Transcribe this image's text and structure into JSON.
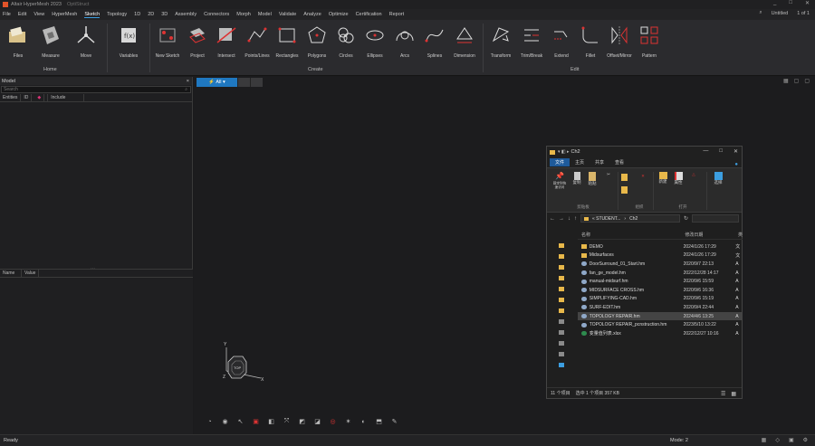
{
  "window": {
    "title": "Altair HyperMesh 2023",
    "profile": "OptiStruct",
    "controls": [
      "_",
      "□",
      "✕"
    ]
  },
  "menu": {
    "items": [
      "File",
      "Edit",
      "View",
      "HyperMesh",
      "Sketch",
      "Topology",
      "1D",
      "2D",
      "3D",
      "Assembly",
      "Connectors",
      "Morph",
      "Model",
      "Validate",
      "Analyze",
      "Optimize",
      "Certification",
      "Report"
    ],
    "active": "Sketch",
    "right_label": "Untitled",
    "page_indicator": "1 of 1"
  },
  "ribbon": {
    "home_buttons": [
      "Files",
      "Measure",
      "Move"
    ],
    "variables": "Variables",
    "create_buttons": [
      "New Sketch",
      "Project",
      "Intersect",
      "Points/Lines",
      "Rectangles",
      "Polygons",
      "Circles",
      "Ellipses",
      "Arcs",
      "Splines",
      "Dimension"
    ],
    "edit_buttons": [
      "Transform",
      "Trim/Break",
      "Extend",
      "Fillet",
      "Offset/Mirror",
      "Pattern"
    ],
    "groups": {
      "home": "Home",
      "create": "Create",
      "edit": "Edit"
    }
  },
  "left_panel": {
    "title": "Model",
    "search_placeholder": "Search",
    "columns": [
      "Entities",
      "ID",
      "",
      "Include"
    ],
    "property_columns": [
      "Name",
      "Value"
    ]
  },
  "viewport": {
    "filter_label": "⚡ All ▾",
    "triad_labels": {
      "y": "Y",
      "x": "X",
      "z": "Z",
      "center": "TOP"
    }
  },
  "status": {
    "text": "Ready",
    "mode": "Mode: 2"
  },
  "explorer": {
    "title": "Ch2",
    "tabs": [
      "文件",
      "主页",
      "共享",
      "查看"
    ],
    "active_tab": "主页",
    "ribbon": {
      "pin": "固定到快速访问",
      "copy": "复制",
      "paste": "粘贴",
      "clipboard_group": "剪贴板",
      "organize_group": "组织",
      "new": "新建",
      "properties": "属性",
      "open_group": "打开",
      "select": "选择"
    },
    "address": {
      "parts": [
        "« STUDENT...",
        "›",
        "Ch2"
      ],
      "nav": [
        "←",
        "→",
        "↓",
        "↑"
      ]
    },
    "columns": {
      "name": "名称",
      "date": "修改日期",
      "type": "类"
    },
    "files": [
      {
        "name": "DEMO",
        "date": "2024/1/26 17:29",
        "type": "文",
        "kind": "folder"
      },
      {
        "name": "Midsurfaces",
        "date": "2024/1/26 17:29",
        "type": "文",
        "kind": "folder"
      },
      {
        "name": "DoorSurround_01_Start.hm",
        "date": "2020/9/7 22:13",
        "type": "A",
        "kind": "hm"
      },
      {
        "name": "fan_ge_model.hm",
        "date": "2022/12/28 14:17",
        "type": "A",
        "kind": "hm"
      },
      {
        "name": "manual-midsurf.hm",
        "date": "2020/9/6 15:59",
        "type": "A",
        "kind": "hm"
      },
      {
        "name": "MIDSURFACE CROSS.hm",
        "date": "2020/9/6 16:36",
        "type": "A",
        "kind": "hm"
      },
      {
        "name": "SIMPLIFYING-CAD.hm",
        "date": "2020/9/6 15:19",
        "type": "A",
        "kind": "hm"
      },
      {
        "name": "SURF-EDIT.hm",
        "date": "2020/9/4 22:44",
        "type": "A",
        "kind": "hm"
      },
      {
        "name": "TOPOLOGY REPAIR.hm",
        "date": "2024/4/6 13:25",
        "type": "A",
        "kind": "hm"
      },
      {
        "name": "TOPOLOGY REPAIR_pcnstruction.hm",
        "date": "2023/5/10 13:22",
        "type": "A",
        "kind": "hm"
      },
      {
        "name": "变量值列表.xlsx",
        "date": "2022/12/27 10:16",
        "type": "A",
        "kind": "xlsx"
      }
    ],
    "selected_file": "TOPOLOGY REPAIR.hm",
    "status": {
      "count": "11 个项目",
      "selected": "选中 1 个项目  357 KB"
    },
    "colors": {
      "folder": "#e8b84a",
      "hm": "#8fa8c8",
      "xlsx": "#2e8b4e",
      "selection": "#444444",
      "accent": "#1e5a9a"
    }
  },
  "colors": {
    "accent_blue": "#1f78c1",
    "logo_orange": "#e2542a",
    "background": "#1b1b1d"
  }
}
